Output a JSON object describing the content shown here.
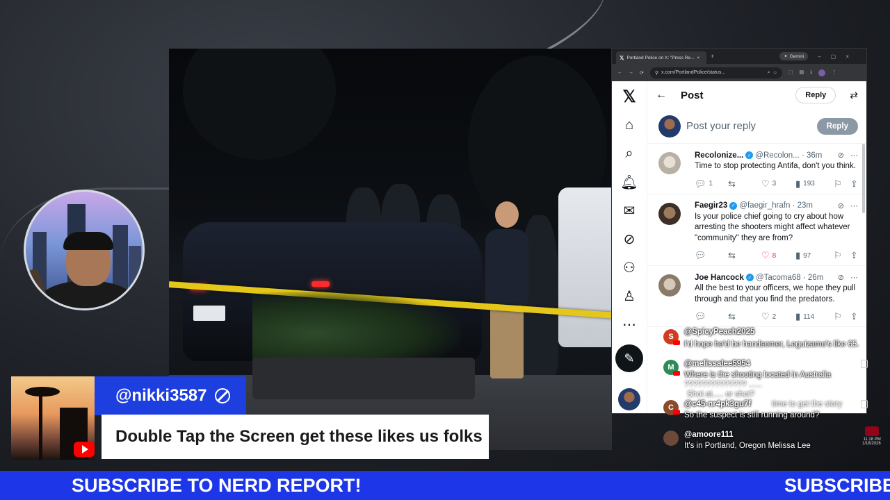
{
  "browser": {
    "tab_title": "Portland Police on X: \"Press Re...",
    "tab_close": "×",
    "new_tab": "+",
    "gemini_label": "Gemini",
    "url": "x.com/PortlandPolice/status...",
    "window_controls": [
      "–",
      "▢",
      "×"
    ]
  },
  "x": {
    "page_title": "Post",
    "reply_pill": "Reply",
    "composer_placeholder": "Post your reply",
    "composer_button": "Reply",
    "tweets": [
      {
        "name": "Recolonize...",
        "handle": "@Recolon... · 36m",
        "text": "Time to stop protecting Antifa, don't you think.",
        "replies": "1",
        "reposts": "",
        "likes": "3",
        "views": "193",
        "liked": false
      },
      {
        "name": "Faegir23",
        "handle": "@faegir_hrafn · 23m",
        "text": "Is your police chief going to cry about how arresting the shooters might affect whatever \"community\" they are from?",
        "replies": "",
        "reposts": "",
        "likes": "8",
        "views": "97",
        "liked": true
      },
      {
        "name": "Joe Hancock",
        "handle": "@Tacoma68 · 26m",
        "text": "All the best to your officers, we hope they pull through and that you find the predators.",
        "replies": "",
        "reposts": "",
        "likes": "2",
        "views": "114",
        "liked": false
      }
    ]
  },
  "chat": [
    {
      "name": "@SpicyPeach2025",
      "message": "I'd hope he'd be handsomer, Leguizamo's like 65.",
      "initial": "S",
      "color": "#d23c1e"
    },
    {
      "name": "@melissalee5954",
      "message": "Where is the shooting located in Australia",
      "initial": "M",
      "color": "#2e8b57"
    },
    {
      "name": "@c45-nr4pk3gu7f",
      "message": "So the suspect is still running around?",
      "initial": "C",
      "color": "#8a4b2d"
    },
    {
      "name": "@amoore111",
      "message": "It's in Portland, Oregon Melissa Lee",
      "initial": "",
      "color": "#6b4a3a"
    }
  ],
  "chat_ghost": [
    "?????????????? ......",
    "Shot at..... or shot?",
    "time to get the story"
  ],
  "clock": {
    "time": "11:18 PM",
    "date": "1/18/2026"
  },
  "stream": {
    "viewer_name": "@nikki3587",
    "message": "Double Tap the Screen get these likes us folks",
    "ticker_left": "SUBSCRIBE TO NERD REPORT!",
    "ticker_right": "SUBSCRIBE"
  },
  "icons": [
    "x-logo-icon",
    "home-icon",
    "search-icon",
    "bell-icon",
    "mail-icon",
    "grok-icon",
    "communities-icon",
    "profile-icon",
    "more-icon",
    "compose-icon"
  ]
}
